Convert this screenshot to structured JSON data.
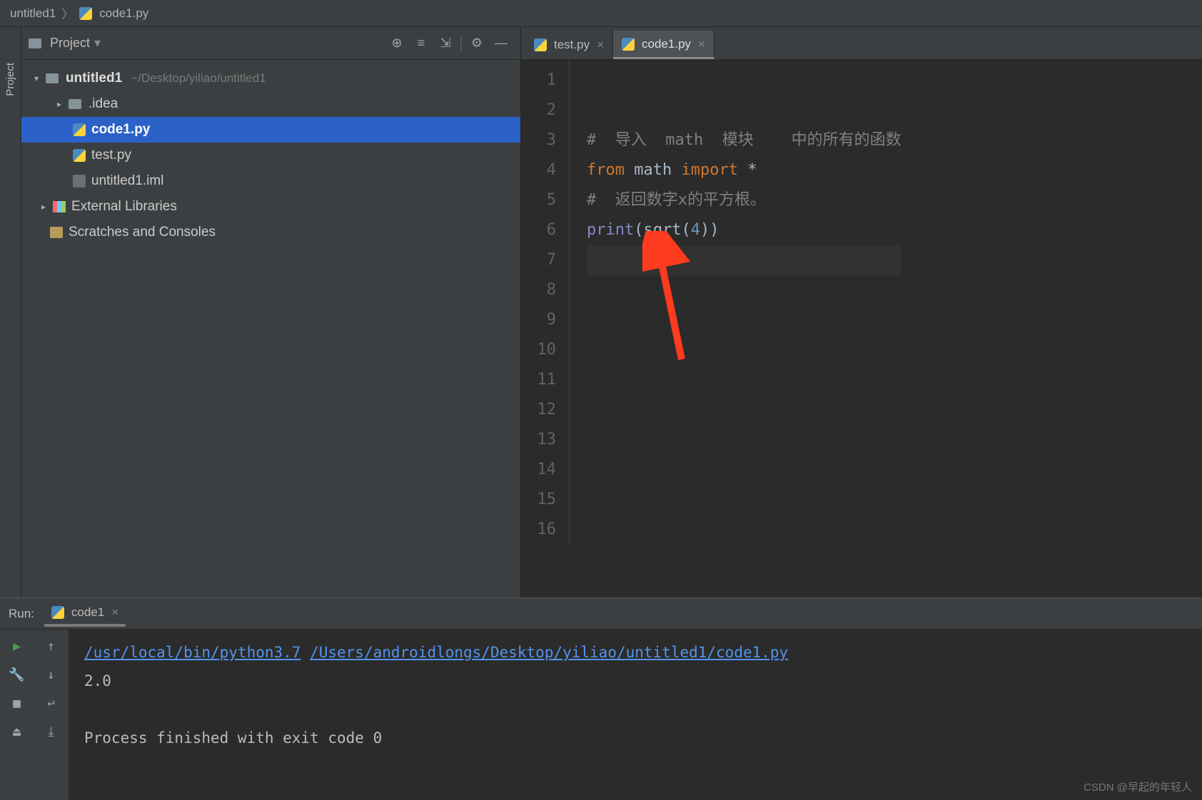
{
  "breadcrumb": {
    "root": "untitled1",
    "file": "code1.py"
  },
  "sidebar_tab": "Project",
  "project_panel": {
    "title": "Project",
    "tree": {
      "root": {
        "name": "untitled1",
        "path": "~/Desktop/yiliao/untitled1"
      },
      "idea_dir": ".idea",
      "file_code1": "code1.py",
      "file_test": "test.py",
      "file_iml": "untitled1.iml",
      "external_libs": "External Libraries",
      "scratches": "Scratches and Consoles"
    }
  },
  "tabs": [
    {
      "label": "test.py",
      "active": false
    },
    {
      "label": "code1.py",
      "active": true
    }
  ],
  "code": {
    "max_line": 16,
    "line3": "#  导入  math  模块    中的所有的函数",
    "line4_from": "from ",
    "line4_math": "math ",
    "line4_import": "import ",
    "line4_star": "*",
    "line5": "#  返回数字x的平方根。",
    "line6_print": "print",
    "line6_paren1": "(",
    "line6_sqrt": "sqrt",
    "line6_paren2": "(",
    "line6_arg": "4",
    "line6_paren3": "))"
  },
  "run_panel": {
    "title": "Run:",
    "tab_label": "code1",
    "interpreter_path": "/usr/local/bin/python3.7",
    "script_path": "/Users/androidlongs/Desktop/yiliao/untitled1/code1.py",
    "output_value": "2.0",
    "exit_msg": "Process finished with exit code 0"
  },
  "watermark": "CSDN @早起的年轻人"
}
